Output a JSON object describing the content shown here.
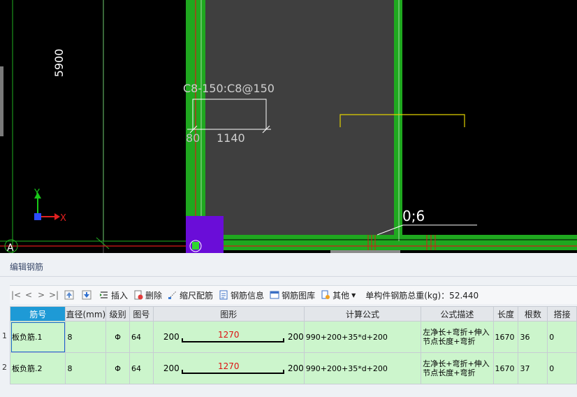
{
  "canvas": {
    "dim_vertical": "5900",
    "rebar_label": "C8-150:C8@150",
    "dim_left": "80",
    "dim_main": "1140",
    "mark_label": "0;6",
    "axis_y": "Y",
    "axis_x": "X",
    "grid_label": "A"
  },
  "panel": {
    "title": "编辑钢筋"
  },
  "toolbar": {
    "nav_first": "|<",
    "nav_prev": "<",
    "nav_next": ">",
    "nav_last": ">|",
    "insert": "插入",
    "delete": "删除",
    "scale": "缩尺配筋",
    "info": "钢筋信息",
    "library": "钢筋图库",
    "other": "其他",
    "weight": "单构件钢筋总重(kg)：52.440"
  },
  "table": {
    "headers": [
      "筋号",
      "直径(mm)",
      "级别",
      "图号",
      "图形",
      "计算公式",
      "公式描述",
      "长度",
      "根数",
      "搭接"
    ],
    "rows": [
      {
        "no": "1",
        "name": "板负筋.1",
        "diameter": "8",
        "grade": "Φ",
        "fig": "64",
        "left": "200",
        "mid": "1270",
        "right": "200",
        "formula": "990+200+35*d+200",
        "desc": "左净长+弯折+伸入节点长度+弯折",
        "length": "1670",
        "count": "36",
        "lap": "0"
      },
      {
        "no": "2",
        "name": "板负筋.2",
        "diameter": "8",
        "grade": "Φ",
        "fig": "64",
        "left": "200",
        "mid": "1270",
        "right": "200",
        "formula": "990+200+35*d+200",
        "desc": "左净长+弯折+伸入节点长度+弯折",
        "length": "1670",
        "count": "37",
        "lap": "0"
      }
    ]
  },
  "colors": {
    "beam_green": "#1fa81f",
    "slab_gray": "#3f3f3f",
    "column_purple": "#6a0dd8",
    "rebar_red": "#d81b1b",
    "row_green": "#ccf5cc",
    "header_blue": "#1e9ad6"
  }
}
